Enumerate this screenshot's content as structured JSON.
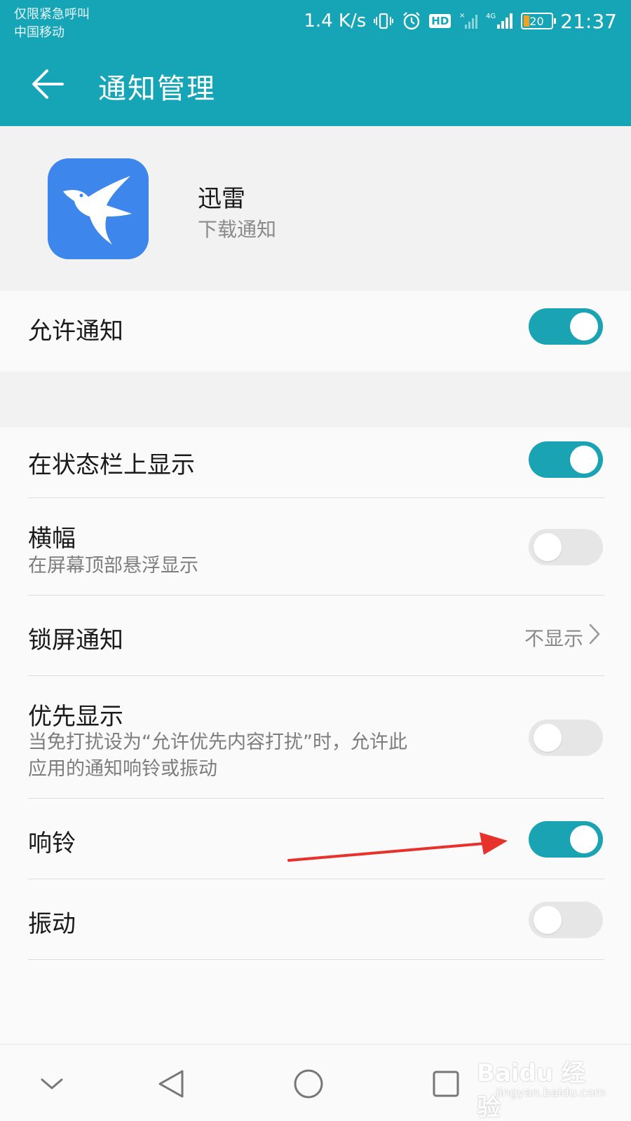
{
  "status_bar": {
    "carrier_line1": "仅限紧急呼叫",
    "carrier_line2": "中国移动",
    "net_speed": "1.4 K/s",
    "hd_badge": "HD",
    "network_type": "4G",
    "battery_level": "20",
    "time": "21:37"
  },
  "header": {
    "title": "通知管理",
    "back_icon": "back-arrow-icon"
  },
  "app": {
    "name": "迅雷",
    "subtitle": "下载通知",
    "icon": "hummingbird-app-icon"
  },
  "settings": {
    "allow": {
      "label": "允许通知",
      "enabled": true
    },
    "statusbar": {
      "label": "在状态栏上显示",
      "enabled": true
    },
    "banner": {
      "label": "横幅",
      "desc": "在屏幕顶部悬浮显示",
      "enabled": false
    },
    "lockscreen": {
      "label": "锁屏通知",
      "value": "不显示"
    },
    "priority": {
      "label": "优先显示",
      "desc_line1": "当免打扰设为“允许优先内容打扰”时，允许此",
      "desc_line2": "应用的通知响铃或振动",
      "enabled": false
    },
    "ring": {
      "label": "响铃",
      "enabled": true
    },
    "vibrate": {
      "label": "振动",
      "enabled": false
    }
  },
  "nav": {
    "back": "triangle-back-icon",
    "home": "circle-home-icon",
    "recents": "square-recents-icon",
    "collapse": "chevron-down-icon"
  },
  "watermark": {
    "main": "Baidu 经验",
    "sub": "jingyan.baidu.com"
  },
  "colors": {
    "accent": "#16a5b7",
    "toggle_on": "#1aa3b3",
    "toggle_off": "#e6e6e6",
    "app_icon": "#3d86ec",
    "annotation_arrow": "#e8312a"
  }
}
